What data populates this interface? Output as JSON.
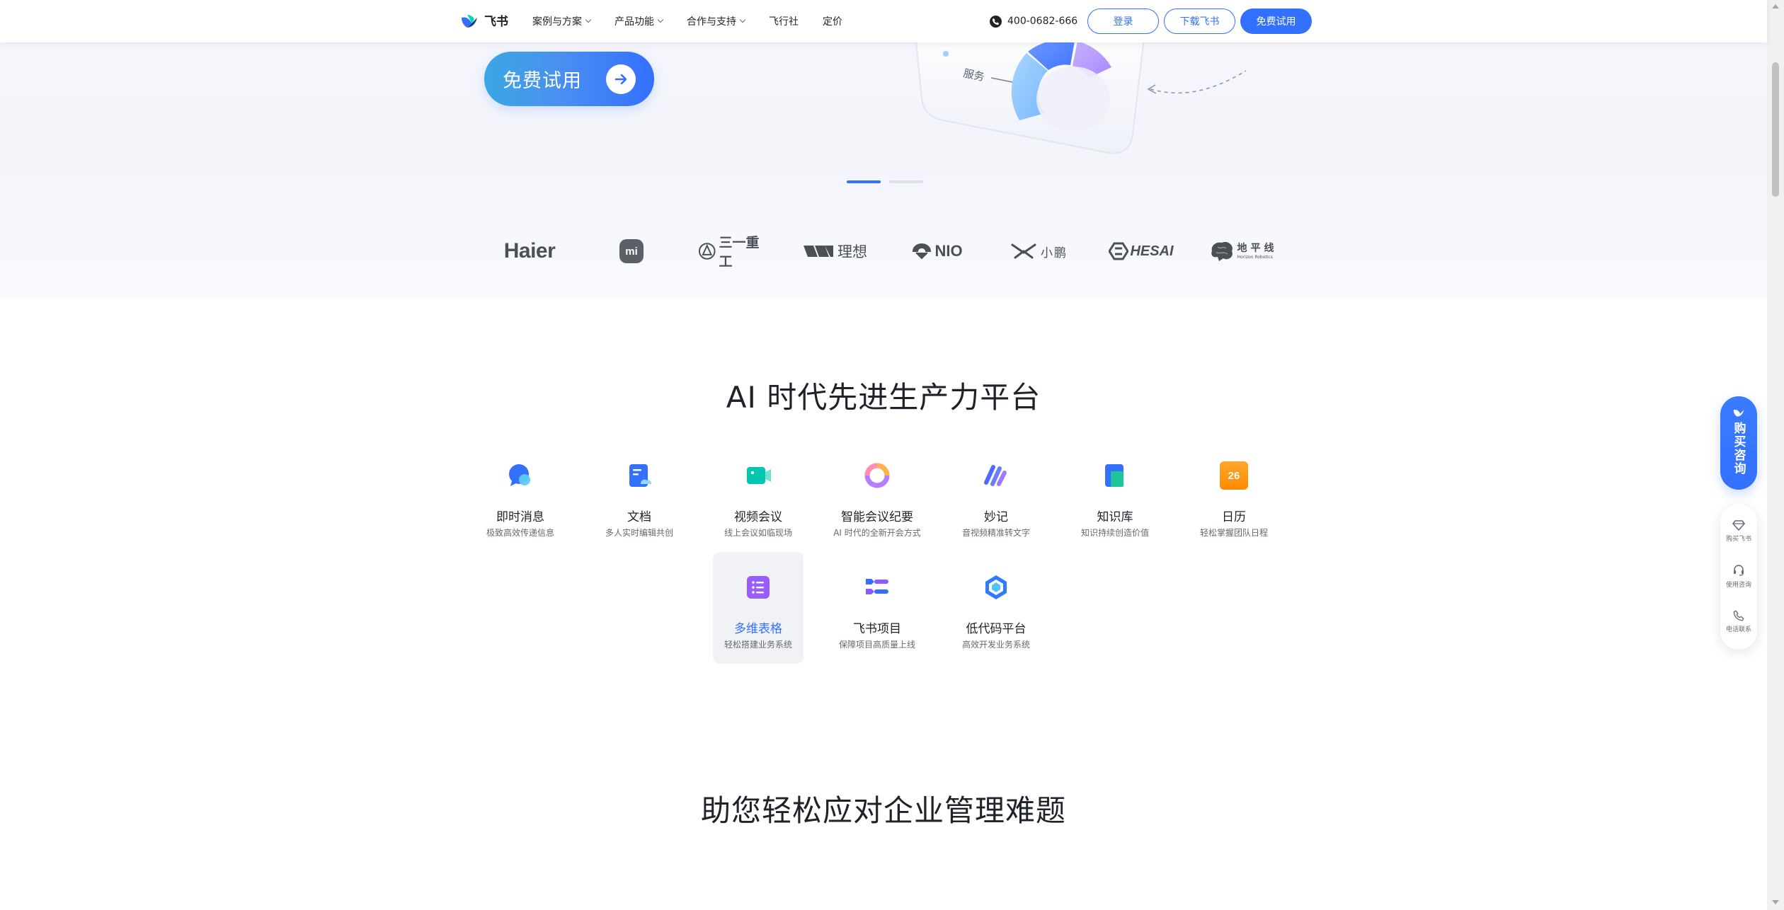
{
  "header": {
    "logo_text": "飞书",
    "nav": [
      {
        "label": "案例与方案",
        "has_dropdown": true
      },
      {
        "label": "产品功能",
        "has_dropdown": true
      },
      {
        "label": "合作与支持",
        "has_dropdown": true
      },
      {
        "label": "飞行社",
        "has_dropdown": false
      },
      {
        "label": "定价",
        "has_dropdown": false
      }
    ],
    "phone": "400-0682-666",
    "login_label": "登录",
    "download_label": "下载飞书",
    "free_trial_label": "免费试用"
  },
  "hero": {
    "cta_label": "免费试用",
    "visual_label": "服务",
    "carousel_pages": 2,
    "carousel_active": 1
  },
  "customers": [
    {
      "name": "Haier"
    },
    {
      "name": "mi"
    },
    {
      "name": "三一重工"
    },
    {
      "name": "理想"
    },
    {
      "name": "NIO"
    },
    {
      "name": "小鹏"
    },
    {
      "name": "HESAI"
    },
    {
      "name": "地平线",
      "sub": "Horizon Robotics"
    }
  ],
  "products_section": {
    "title": "AI 时代先进生产力平台",
    "items": [
      {
        "title": "即时消息",
        "subtitle": "极致高效传递信息",
        "icon": "chat-bubble-icon"
      },
      {
        "title": "文档",
        "subtitle": "多人实时编辑共创",
        "icon": "document-icon"
      },
      {
        "title": "视频会议",
        "subtitle": "线上会议如临现场",
        "icon": "video-camera-icon"
      },
      {
        "title": "智能会议纪要",
        "subtitle": "AI 时代的全新开会方式",
        "icon": "ai-ring-icon"
      },
      {
        "title": "妙记",
        "subtitle": "音视频精准转文字",
        "icon": "minutes-wave-icon"
      },
      {
        "title": "知识库",
        "subtitle": "知识持续创造价值",
        "icon": "knowledge-base-icon"
      },
      {
        "title": "日历",
        "subtitle": "轻松掌握团队日程",
        "icon": "calendar-icon",
        "badge": "26"
      },
      {
        "title": "多维表格",
        "subtitle": "轻松搭建业务系统",
        "icon": "base-table-icon"
      },
      {
        "title": "飞书项目",
        "subtitle": "保障项目高质量上线",
        "icon": "project-icon"
      },
      {
        "title": "低代码平台",
        "subtitle": "高效开发业务系统",
        "icon": "low-code-icon"
      }
    ],
    "hovered_index": 7
  },
  "next_section": {
    "title": "助您轻松应对企业管理难题"
  },
  "float": {
    "buy_label": "购买咨询",
    "items": [
      {
        "label": "购买飞书",
        "icon": "diamond-icon"
      },
      {
        "label": "使用咨询",
        "icon": "headset-icon"
      },
      {
        "label": "电话联系",
        "icon": "phone-icon"
      }
    ]
  },
  "colors": {
    "brand": "#3370ff",
    "text": "#1f2329",
    "subtext": "#646a73"
  }
}
